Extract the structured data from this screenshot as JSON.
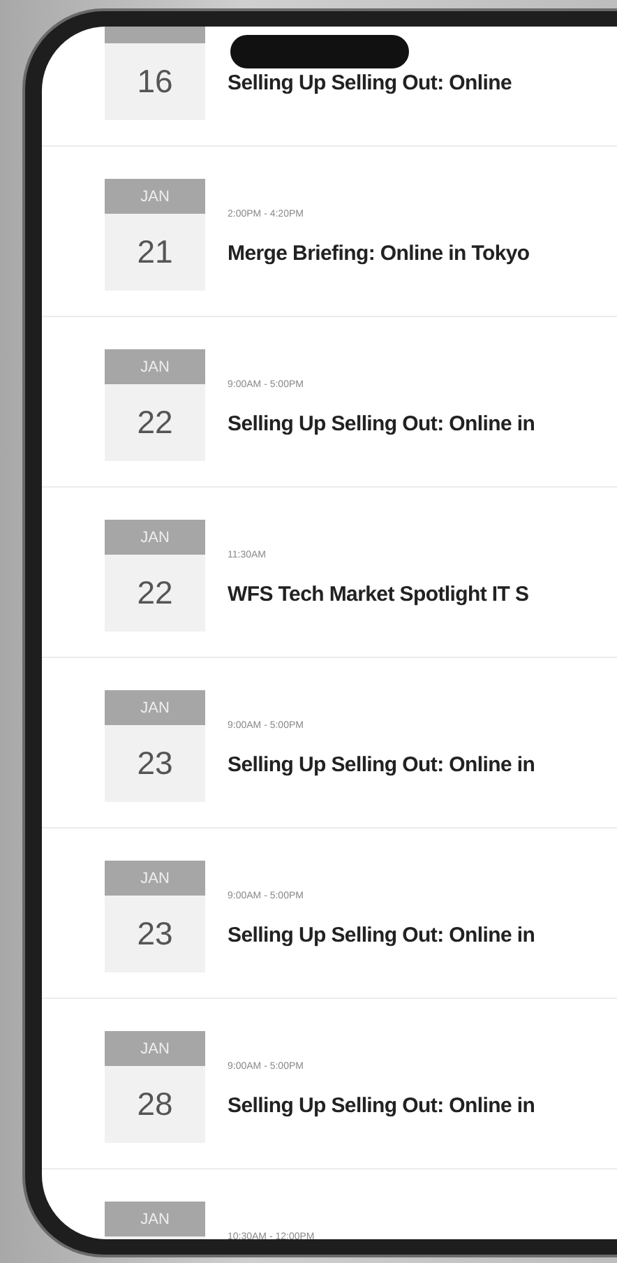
{
  "events": [
    {
      "day": "16",
      "title": "Selling Up Selling Out: Online"
    },
    {
      "month": "JAN",
      "day": "21",
      "time": "2:00PM - 4:20PM",
      "title": "Merge Briefing: Online in Tokyo"
    },
    {
      "month": "JAN",
      "day": "22",
      "time": "9:00AM - 5:00PM",
      "title": "Selling Up Selling Out: Online in"
    },
    {
      "month": "JAN",
      "day": "22",
      "time": "11:30AM",
      "title": "WFS Tech Market Spotlight IT S"
    },
    {
      "month": "JAN",
      "day": "23",
      "time": "9:00AM - 5:00PM",
      "title": "Selling Up Selling Out: Online in"
    },
    {
      "month": "JAN",
      "day": "23",
      "time": "9:00AM - 5:00PM",
      "title": "Selling Up Selling Out: Online in"
    },
    {
      "month": "JAN",
      "day": "28",
      "time": "9:00AM - 5:00PM",
      "title": "Selling Up Selling Out: Online in"
    },
    {
      "month": "JAN",
      "time": "10:30AM - 12:00PM"
    }
  ]
}
